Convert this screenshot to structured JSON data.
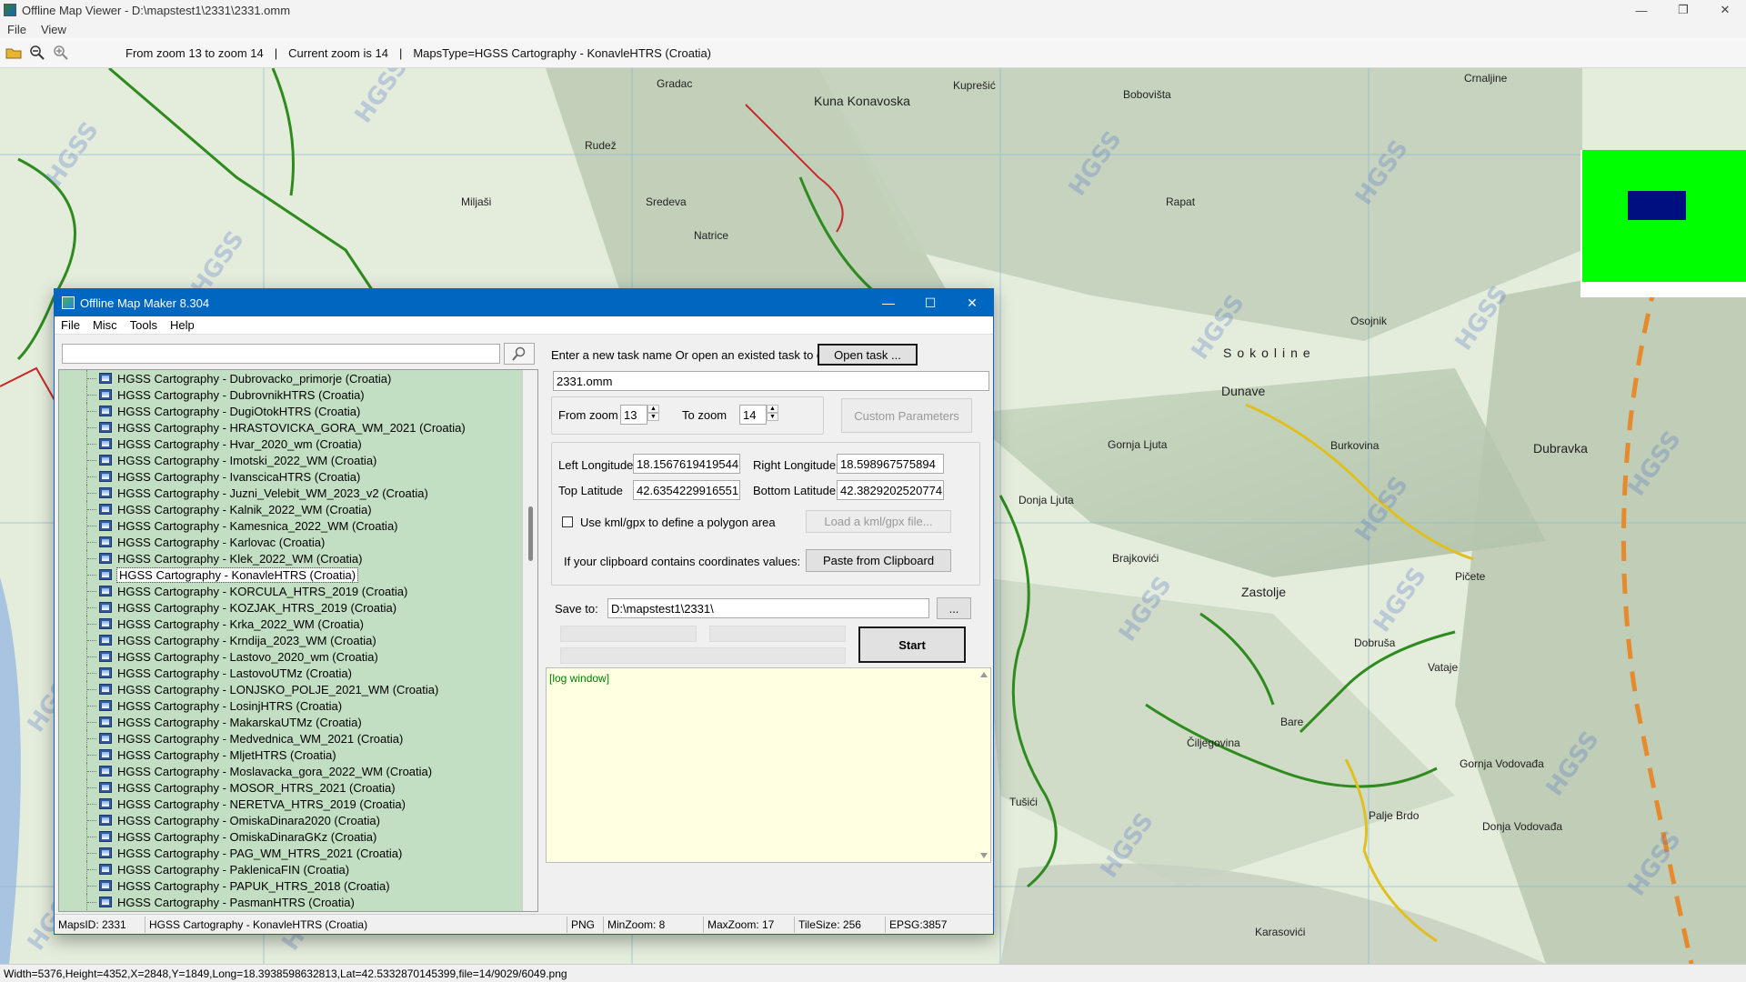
{
  "viewer": {
    "title": "Offline Map Viewer - D:\\mapstest1\\2331\\2331.omm",
    "menu": [
      "File",
      "View"
    ],
    "toolbar": {
      "zoom_range": "From zoom 13 to zoom 14",
      "sep1": "|",
      "current_zoom": "Current zoom is 14",
      "sep2": "|",
      "maps_type": "MapsType=HGSS Cartography - KonavleHTRS (Croatia)"
    },
    "status": "Width=5376,Height=4352,X=2848,Y=1849,Long=18.3938598632813,Lat=42.5332870145399,file=14/9029/6049.png"
  },
  "map": {
    "labels": [
      "Kuna Konavoska",
      "Rudež",
      "Miljaši",
      "Sredeva",
      "Natrice",
      "Bobovišta",
      "Rapat",
      "Crnaljine",
      "Sokoline",
      "Dunave",
      "Gornja Ljuta",
      "Burkovina",
      "Dubravka",
      "Donja Ljuta",
      "Brajkovići",
      "Zastolje",
      "Dobruša",
      "Vataje",
      "Pičete",
      "Čiljegovina",
      "Bare",
      "Gornja Vodovađa",
      "Palje Brdo",
      "Donja Vodovađa",
      "Tušići",
      "Karasovići",
      "Gradac",
      "Kuprešić",
      "Osojnik"
    ],
    "watermark": "HGSS"
  },
  "dialog": {
    "title": "Offline Map Maker 8.304",
    "menu": [
      "File",
      "Misc",
      "Tools",
      "Help"
    ],
    "search": {
      "value": "",
      "placeholder": ""
    },
    "tree_items": [
      "HGSS Cartography - Dubrovacko_primorje (Croatia)",
      "HGSS Cartography - DubrovnikHTRS (Croatia)",
      "HGSS Cartography - DugiOtokHTRS (Croatia)",
      "HGSS Cartography - HRASTOVICKA_GORA_WM_2021 (Croatia)",
      "HGSS Cartography - Hvar_2020_wm (Croatia)",
      "HGSS Cartography - Imotski_2022_WM (Croatia)",
      "HGSS Cartography - IvanscicaHTRS (Croatia)",
      "HGSS Cartography - Juzni_Velebit_WM_2023_v2 (Croatia)",
      "HGSS Cartography - Kalnik_2022_WM (Croatia)",
      "HGSS Cartography - Kamesnica_2022_WM (Croatia)",
      "HGSS Cartography - Karlovac (Croatia)",
      "HGSS Cartography - Klek_2022_WM (Croatia)",
      "HGSS Cartography - KonavleHTRS (Croatia)",
      "HGSS Cartography - KORCULA_HTRS_2019 (Croatia)",
      "HGSS Cartography - KOZJAK_HTRS_2019 (Croatia)",
      "HGSS Cartography - Krka_2022_WM (Croatia)",
      "HGSS Cartography - Krndija_2023_WM (Croatia)",
      "HGSS Cartography - Lastovo_2020_wm (Croatia)",
      "HGSS Cartography - LastovoUTMz (Croatia)",
      "HGSS Cartography - LONJSKO_POLJE_2021_WM (Croatia)",
      "HGSS Cartography - LosinjHTRS (Croatia)",
      "HGSS Cartography - MakarskaUTMz (Croatia)",
      "HGSS Cartography - Medvednica_WM_2021 (Croatia)",
      "HGSS Cartography - MljetHTRS (Croatia)",
      "HGSS Cartography - Moslavacka_gora_2022_WM (Croatia)",
      "HGSS Cartography - MOSOR_HTRS_2021 (Croatia)",
      "HGSS Cartography - NERETVA_HTRS_2019 (Croatia)",
      "HGSS Cartography - OmiskaDinara2020 (Croatia)",
      "HGSS Cartography - OmiskaDinaraGKz (Croatia)",
      "HGSS Cartography - PAG_WM_HTRS_2021 (Croatia)",
      "HGSS Cartography - PaklenicaFIN (Croatia)",
      "HGSS Cartography - PAPUK_HTRS_2018 (Croatia)",
      "HGSS Cartography - PasmanHTRS (Croatia)"
    ],
    "selected_index": 12,
    "task_prompt": "Enter a new task name Or open an existed task to continue:",
    "open_task": "Open task ...",
    "task_name": "2331.omm",
    "from_zoom_label": "From zoom",
    "from_zoom": "13",
    "to_zoom_label": "To zoom",
    "to_zoom": "14",
    "custom_params": "Custom Parameters",
    "left_lon_label": "Left Longitude",
    "left_lon": "18.1567619419544",
    "right_lon_label": "Right Longitude",
    "right_lon": "18.598967575894",
    "top_lat_label": "Top Latitude",
    "top_lat": "42.6354229916551",
    "bottom_lat_label": "Bottom Latitude",
    "bottom_lat": "42.3829202520774",
    "use_kml_label": "Use kml/gpx to define a polygon area",
    "load_kml": "Load a kml/gpx file...",
    "clipboard_label": "If your clipboard contains coordinates values:",
    "paste_clipboard": "Paste from Clipboard",
    "save_to_label": "Save to:",
    "save_to": "D:\\mapstest1\\2331\\",
    "browse": "...",
    "start": "Start",
    "log": "[log window]",
    "status": {
      "maps_id": "MapsID: 2331",
      "map_name": "HGSS Cartography - KonavleHTRS (Croatia)",
      "format": "PNG",
      "min_zoom": "MinZoom: 8",
      "max_zoom": "MaxZoom: 17",
      "tile_size": "TileSize: 256",
      "epsg": "EPSG:3857"
    }
  },
  "colors": {
    "dialog_title": "#0067c0",
    "tree_bg": "#c3dfc3",
    "log_bg": "#ffffe1",
    "overview_green": "#00ff00",
    "overview_blue": "#000f80",
    "trail_green": "#2e8b1e",
    "road_yellow": "#e0c020",
    "border_orange": "#e68a2e"
  }
}
